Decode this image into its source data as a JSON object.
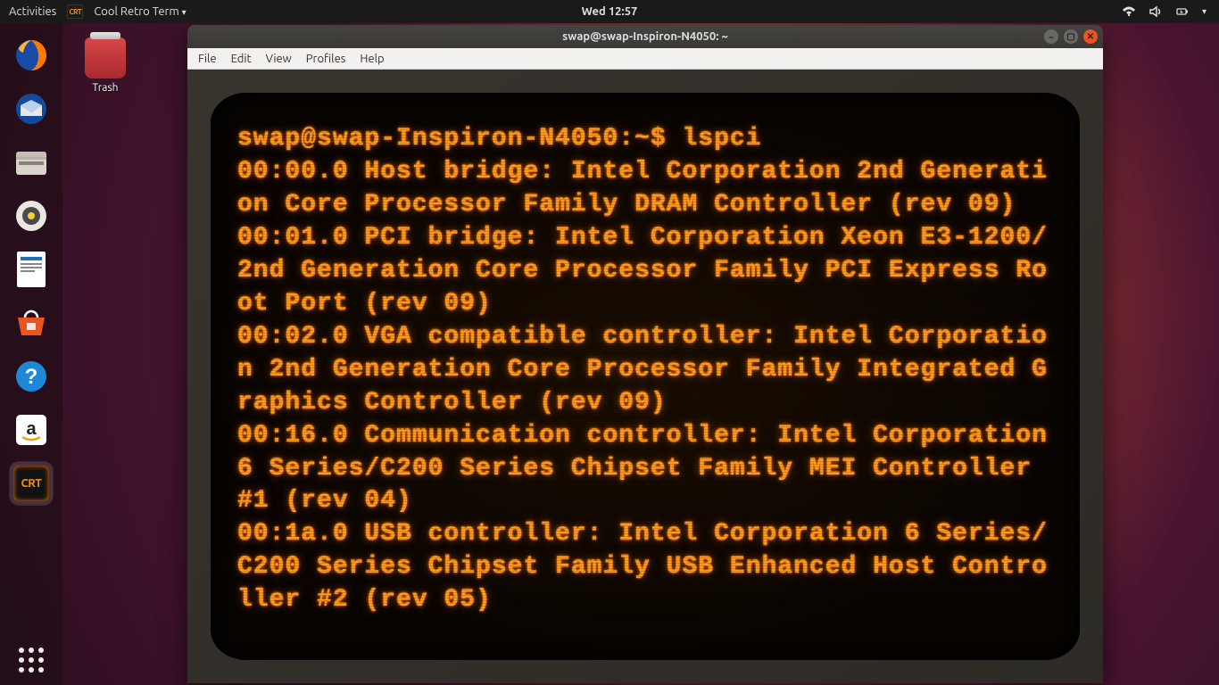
{
  "topbar": {
    "activities": "Activities",
    "app_name": "Cool Retro Term",
    "clock": "Wed 12:57"
  },
  "desktop": {
    "trash_label": "Trash"
  },
  "window": {
    "title": "swap@swap-Inspiron-N4050: ~",
    "menu": {
      "file": "File",
      "edit": "Edit",
      "view": "View",
      "profiles": "Profiles",
      "help": "Help"
    }
  },
  "terminal": {
    "prompt": "swap@swap-Inspiron-N4050:~$ ",
    "command": "lspci",
    "output": "00:00.0 Host bridge: Intel Corporation 2nd Generation Core Processor Family DRAM Controller (rev 09)\n00:01.0 PCI bridge: Intel Corporation Xeon E3-1200/2nd Generation Core Processor Family PCI Express Root Port (rev 09)\n00:02.0 VGA compatible controller: Intel Corporation 2nd Generation Core Processor Family Integrated Graphics Controller (rev 09)\n00:16.0 Communication controller: Intel Corporation 6 Series/C200 Series Chipset Family MEI Controller #1 (rev 04)\n00:1a.0 USB controller: Intel Corporation 6 Series/C200 Series Chipset Family USB Enhanced Host Controller #2 (rev 05)"
  }
}
